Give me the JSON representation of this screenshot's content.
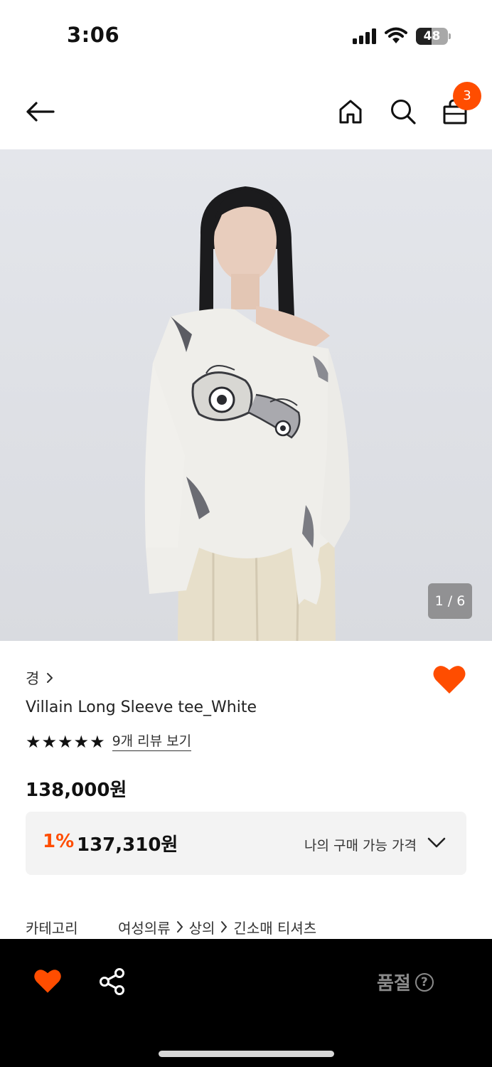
{
  "status_bar": {
    "time": "3:06",
    "battery_level": "48",
    "battery_fraction": 0.48
  },
  "header": {
    "cart_count": "3"
  },
  "gallery": {
    "counter": "1 / 6"
  },
  "product": {
    "brand": "경",
    "title": "Villain Long Sleeve tee_White",
    "rating_stars": 5,
    "review_link": "9개 리뷰 보기",
    "price": "138,000원"
  },
  "price_box": {
    "discount_rate": "1%",
    "discount_price": "137,310원",
    "label": "나의 구매 가능 가격"
  },
  "category": {
    "label": "카테고리",
    "path": [
      "여성의류",
      "상의",
      "긴소매 티셔츠"
    ]
  },
  "bottom_bar": {
    "soldout_label": "품절",
    "help_symbol": "?"
  },
  "colors": {
    "accent": "#ff4d00",
    "bottom_bar_bg": "#000000",
    "price_box_bg": "#f3f3f3",
    "image_bg": "#dfe1e6"
  },
  "icons": [
    "back-arrow-icon",
    "home-icon",
    "search-icon",
    "shopping-bag-icon",
    "heart-icon",
    "share-icon",
    "chevron-down-icon",
    "help-icon"
  ]
}
